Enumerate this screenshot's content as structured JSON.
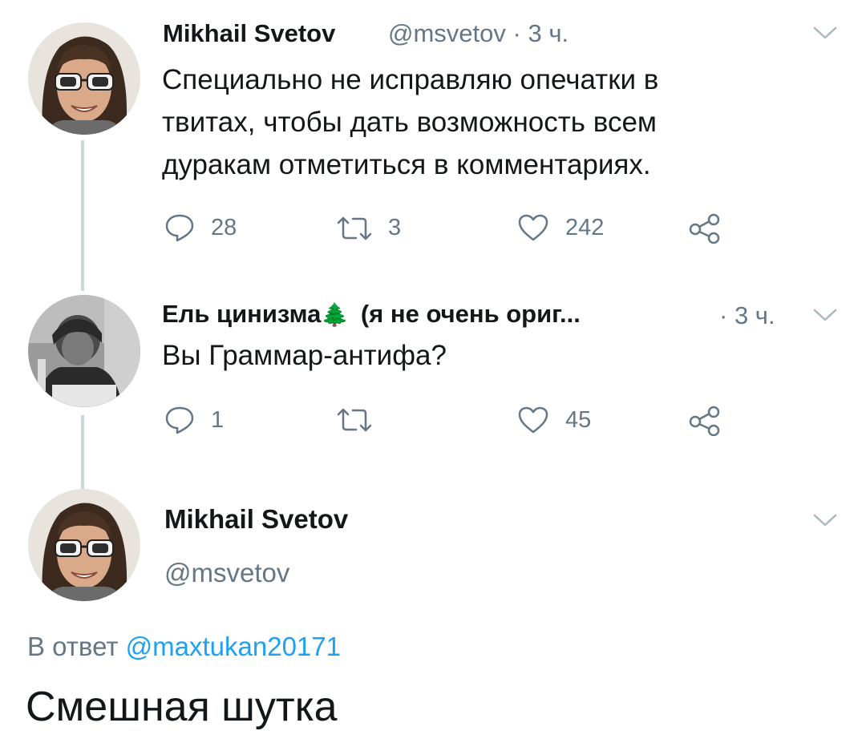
{
  "tweet1": {
    "author_name": "Mikhail Svetov",
    "handle": "@msvetov",
    "separator": "·",
    "time": "3 ч.",
    "text_lines": [
      "Специально не исправляю опечатки в",
      "твитах, чтобы дать возможность всем",
      "дуракам отметиться в комментариях."
    ],
    "replies": "28",
    "retweets": "3",
    "likes": "242"
  },
  "tweet2": {
    "author_name": "Ель цинизма",
    "name_emoji": "🌲",
    "name_suffix": "(я не очень ориг...",
    "separator": "·",
    "time": "3 ч.",
    "text": "Вы Граммар-антифа?",
    "replies": "1",
    "retweets": "",
    "likes": "45"
  },
  "main_tweet": {
    "author_name": "Mikhail Svetov",
    "handle": "@msvetov",
    "reply_prefix": "В ответ",
    "reply_to": "@maxtukan20171",
    "text": "Смешная шутка"
  },
  "icons": {
    "reply": "reply-icon",
    "retweet": "retweet-icon",
    "like": "heart-icon",
    "share": "share-icon",
    "menu": "chevron-down-icon"
  },
  "colors": {
    "text": "#14171a",
    "muted": "#657786",
    "link": "#1da1f2",
    "thread_line": "#ccd6dd"
  }
}
